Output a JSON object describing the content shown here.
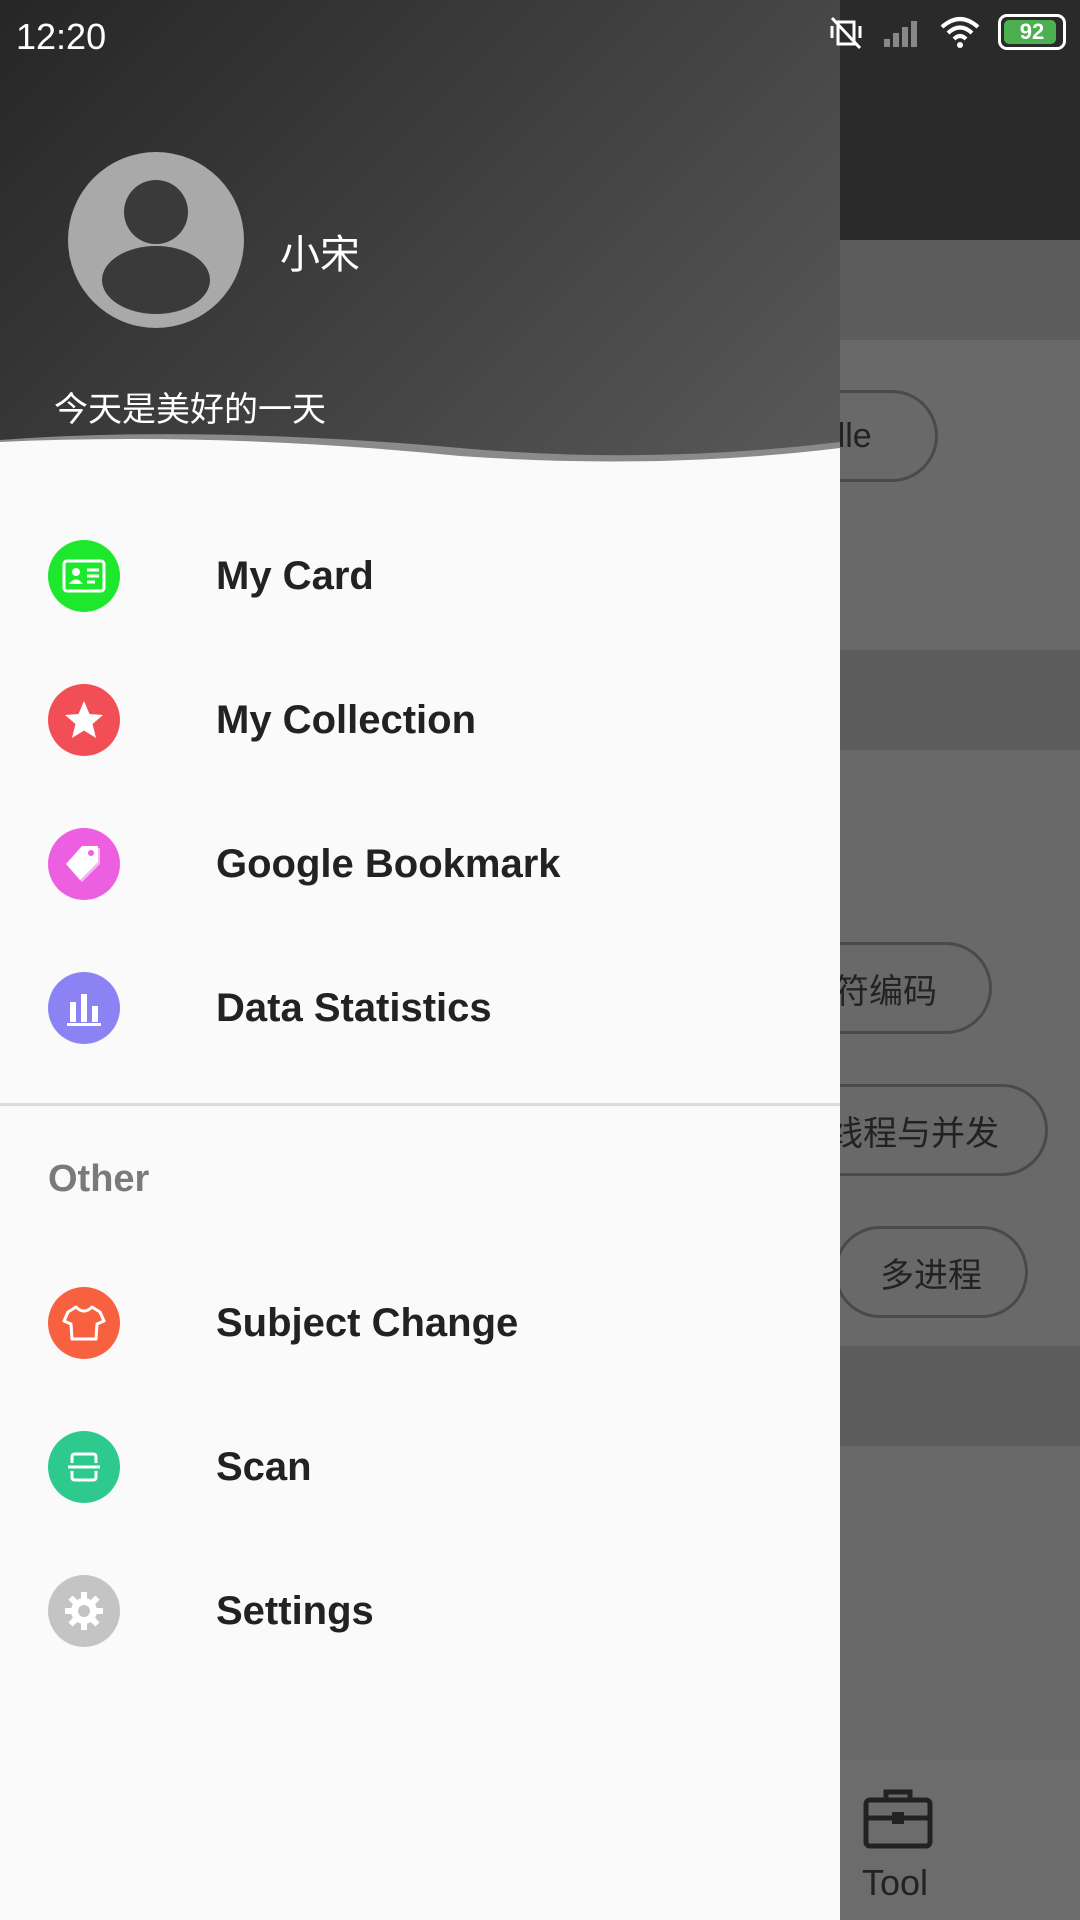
{
  "status_bar": {
    "time": "12:20",
    "battery_level": "92",
    "battery_color": "#4caf50"
  },
  "drawer": {
    "user_name": "小宋",
    "motto": "今天是美好的一天",
    "primary_items": [
      {
        "label": "My Card",
        "icon": "id-card-icon",
        "color": "#1ee82e"
      },
      {
        "label": "My Collection",
        "icon": "star-icon",
        "color": "#f24e55"
      },
      {
        "label": "Google Bookmark",
        "icon": "tag-icon",
        "color": "#ec5fe0"
      },
      {
        "label": "Data Statistics",
        "icon": "bar-chart-icon",
        "color": "#8b83f4"
      }
    ],
    "section_title": "Other",
    "other_items": [
      {
        "label": "Subject Change",
        "icon": "shirt-icon",
        "color": "#f76140"
      },
      {
        "label": "Scan",
        "icon": "scan-icon",
        "color": "#2ec98c"
      },
      {
        "label": "Settings",
        "icon": "gear-icon",
        "color": "#c4c4c4"
      }
    ]
  },
  "background": {
    "chips": [
      "dle",
      "符编码",
      "线程与并发",
      "多进程"
    ],
    "bottom_nav_label": "Tool"
  }
}
